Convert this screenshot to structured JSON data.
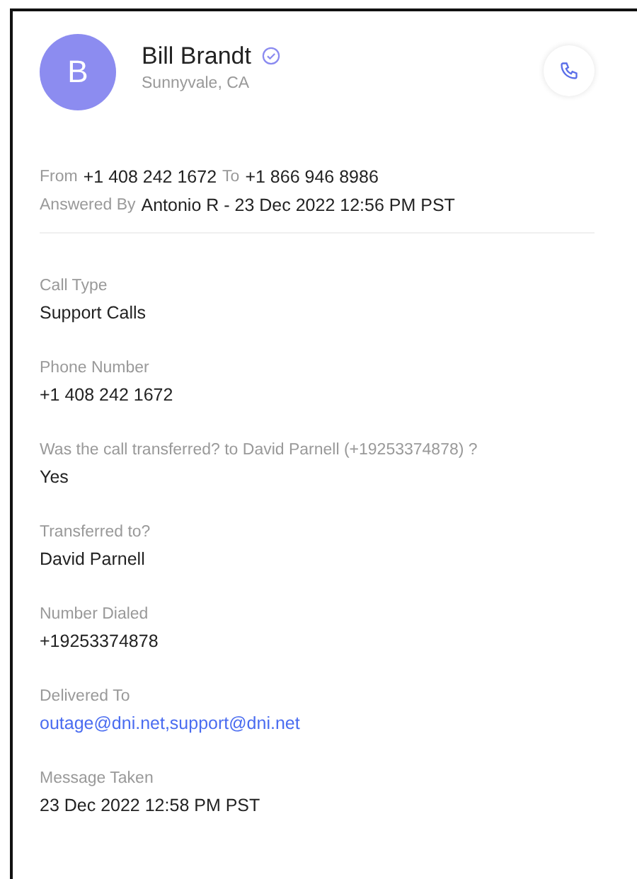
{
  "contact": {
    "initial": "B",
    "name": "Bill Brandt",
    "verified": true,
    "location": "Sunnyvale, CA"
  },
  "call": {
    "from_label": "From",
    "from": "+1 408 242 1672",
    "to_label": "To",
    "to": "+1 866 946 8986",
    "answered_label": "Answered By",
    "answered": "Antonio R - 23 Dec 2022 12:56 PM PST"
  },
  "fields": [
    {
      "label": "Call Type",
      "value": "Support Calls",
      "kind": "text"
    },
    {
      "label": "Phone Number",
      "value": "+1 408 242 1672",
      "kind": "text"
    },
    {
      "label": "Was the call transferred? to David Parnell (+19253374878) ?",
      "value": "Yes",
      "kind": "text"
    },
    {
      "label": "Transferred to?",
      "value": "David Parnell",
      "kind": "text"
    },
    {
      "label": "Number Dialed",
      "value": "+19253374878",
      "kind": "text"
    },
    {
      "label": "Delivered To",
      "value": "outage@dni.net,support@dni.net",
      "kind": "link"
    },
    {
      "label": "Message Taken",
      "value": "23 Dec 2022 12:58 PM PST",
      "kind": "text"
    }
  ]
}
